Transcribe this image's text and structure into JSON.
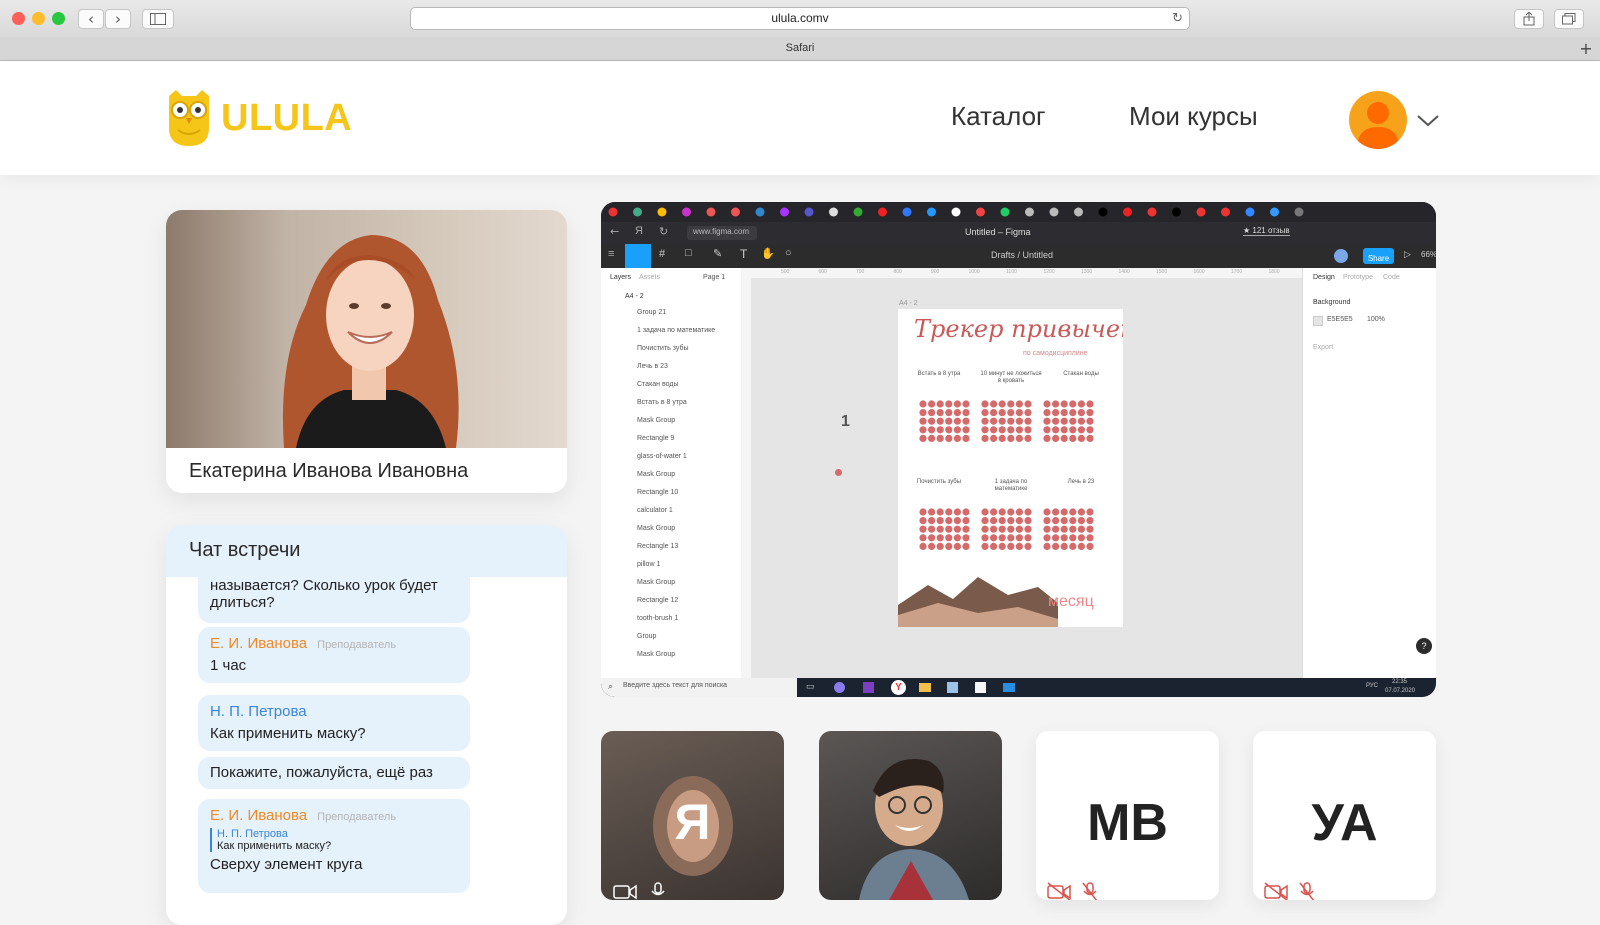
{
  "browser": {
    "url": "ulula.comv",
    "tab_title": "Safari"
  },
  "site": {
    "logo_text": "ULULA",
    "nav": {
      "catalog": "Каталог",
      "my_courses": "Мои курсы"
    }
  },
  "teacher": {
    "name": "Екатерина Иванова Ивановна"
  },
  "chat": {
    "title": "Чат встречи",
    "messages": [
      {
        "text": "называется? Сколько урок будет длиться?"
      },
      {
        "author": "Е. И. Иванова",
        "role": "Преподаватель",
        "text": "1 час"
      },
      {
        "author": "Н. П. Петрова",
        "text": "Как применить маску?"
      },
      {
        "text": "Покажите, пожалуйста, ещё раз"
      },
      {
        "author": "Е. И. Иванова",
        "role": "Преподаватель",
        "quote_author": "Н. П. Петрова",
        "quote_text": "Как применить маску?",
        "text": "Сверху элемент круга"
      }
    ]
  },
  "screen_share": {
    "browser_url": "www.figma.com",
    "window_title": "Untitled – Figma",
    "reviews": "★ 121 отзыв",
    "breadcrumb": "Drafts / Untitled",
    "share_label": "Share",
    "zoom": "66%",
    "left_tabs": [
      "Layers",
      "Assets",
      "Page 1"
    ],
    "frame_name": "A4 - 2",
    "layers": [
      "Group 21",
      "1 задача по математике",
      "Почистить зубы",
      "Лечь в 23",
      "Стакан воды",
      "Встать в 8 утра",
      "Mask Group",
      "Rectangle 9",
      "glass-of-water 1",
      "Mask Group",
      "Rectangle 10",
      "calculator 1",
      "Mask Group",
      "Rectangle 13",
      "pillow 1",
      "Mask Group",
      "Rectangle 12",
      "tooth-brush 1",
      "Group",
      "Mask Group"
    ],
    "right_tabs": [
      "Design",
      "Prototype",
      "Code"
    ],
    "background_label": "Background",
    "background_hex": "E5E5E5",
    "background_opacity": "100%",
    "export_label": "Export",
    "ruler": [
      "500",
      "600",
      "700",
      "800",
      "900",
      "1000",
      "1100",
      "1200",
      "1300",
      "1400",
      "1500",
      "1600",
      "1700",
      "1800"
    ],
    "canvas_tag": "1",
    "doc": {
      "title": "Трекер привычек",
      "subtitle": "по самодисциплине",
      "row1": [
        "Встать в 8 утра",
        "10 минут не ложиться в кровать",
        "Стакан воды"
      ],
      "row2": [
        "Почистить зубы",
        "1 задача по математике",
        "Лечь в 23"
      ],
      "footer": "месяц"
    },
    "taskbar": {
      "search": "Введите здесь текст для поиска",
      "lang": "РУС",
      "time": "22:35",
      "date": "07.07.2020"
    }
  },
  "participants": [
    {
      "label": "Я"
    },
    {
      "label": ""
    },
    {
      "label": "МВ"
    },
    {
      "label": "УА"
    }
  ],
  "colors": {
    "brand": "#f5c518",
    "chat_bubble": "#e5f1fb",
    "teacher_name": "#f08a24",
    "student_name": "#3b86d4",
    "figma_accent": "#18a0fb",
    "habit_dot": "#d46a6a"
  }
}
